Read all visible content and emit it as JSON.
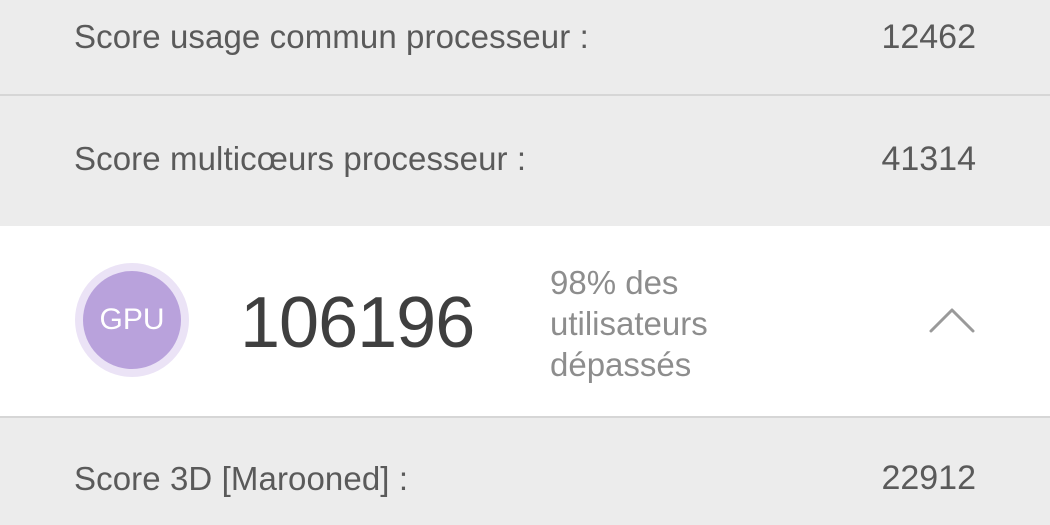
{
  "rows": {
    "cpu_single": {
      "label": "Score usage commun processeur :",
      "value": "12462"
    },
    "cpu_multi": {
      "label": "Score multicœurs processeur :",
      "value": "41314"
    },
    "gpu_3d": {
      "label": "Score 3D [Marooned] :",
      "value": "22912"
    }
  },
  "gpu_card": {
    "badge_label": "GPU",
    "score": "106196",
    "percent_lines": [
      "98% des",
      "utilisateurs",
      "dépassés"
    ],
    "toggle_icon": "chevron-up-icon"
  },
  "colors": {
    "background": "#ececec",
    "card": "#ffffff",
    "badge": "#b9a2dc",
    "badge_ring": "#ebe3f6",
    "primary_text": "#5a5a5a",
    "secondary_text": "#8d8d8d",
    "divider": "#d6d6d6"
  }
}
